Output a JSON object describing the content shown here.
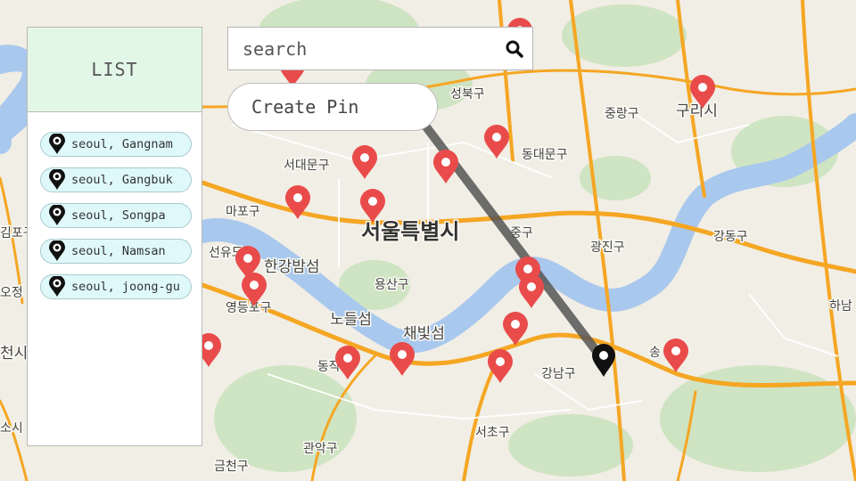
{
  "sidebar": {
    "title": "LIST",
    "items": [
      {
        "label": "seoul, Gangnam"
      },
      {
        "label": "seoul, Gangbuk"
      },
      {
        "label": "seoul, Songpa"
      },
      {
        "label": "seoul, Namsan"
      },
      {
        "label": "seoul, joong-gu"
      }
    ]
  },
  "search": {
    "placeholder": "search",
    "value": "",
    "icon": "search-icon"
  },
  "create_pin": {
    "label": "Create Pin",
    "icon": "map-pin-icon"
  },
  "map": {
    "labels": {
      "city": "서울특별시",
      "seongbuk": "성북구",
      "jungnang": "중랑구",
      "guri": "구리시",
      "seodaemun": "서대문구",
      "dongdaemun": "동대문구",
      "mapo": "마포구",
      "jung": "중구",
      "gwangjin": "광진구",
      "gangdong": "강동구",
      "hangang_park": "한강밤섬",
      "yongsan": "용산구",
      "yeongdeungpo": "영등포구",
      "nodeulseom": "노들섬",
      "chaebitseom": "채빛섬",
      "gangnam": "강남구",
      "seocho": "서초구",
      "gwanak": "관악구",
      "geumcheon": "금천구",
      "hanam": "하남",
      "dongjak": "동작",
      "songpa": "송",
      "gimpo": "김포구",
      "yangcheon": "오정",
      "seonyu": "선유도",
      "cheon": "천시",
      "so": "소시"
    },
    "colors": {
      "water": "#a9c8ee",
      "road": "#f5a623",
      "pin": "#e94b4b",
      "route": "#555555"
    }
  }
}
